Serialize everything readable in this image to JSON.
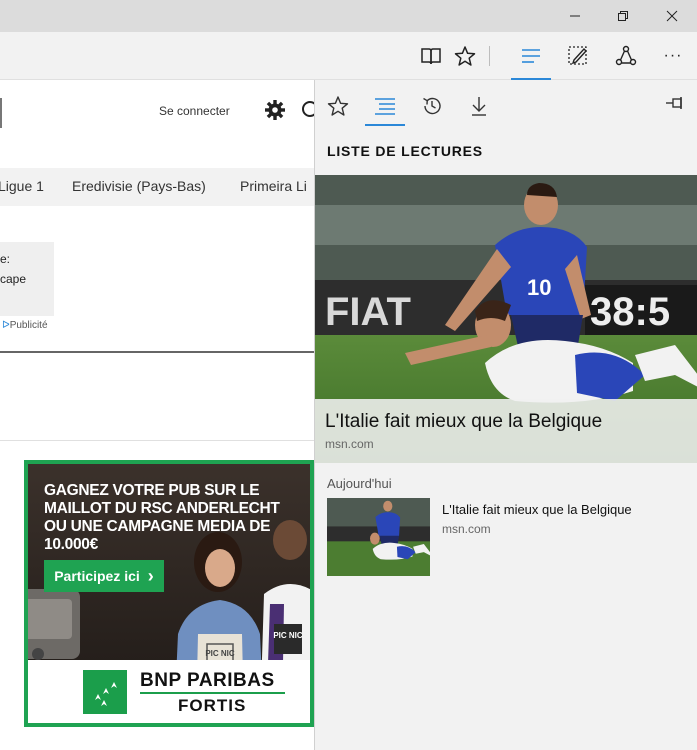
{
  "toolbar": {
    "icons": [
      "reading-view-icon",
      "favorites-star-icon",
      "hub-icon",
      "web-note-icon",
      "share-icon",
      "more-icon"
    ],
    "more_label": "···"
  },
  "page": {
    "signin": "Se connecter",
    "nav": [
      "Ligue 1",
      "Eredivisie (Pays-Bas)",
      "Primeira Li"
    ],
    "ad_lines": [
      "e:",
      "cape"
    ],
    "ad_label": "Publicité",
    "banner": {
      "title": "GAGNEZ VOTRE PUB SUR LE MAILLOT DU RSC ANDERLECHT OU UNE CAMPAGNE MEDIA DE 10.000€",
      "cta": "Participez ici",
      "cta_arrow": "›",
      "apron_left": "PIC NIC",
      "apron_right": "PIC NIC",
      "brand": "BNP PARIBAS",
      "brand_sub": "FORTIS"
    }
  },
  "hub": {
    "title": "LISTE DE LECTURES",
    "hero": {
      "title": "L'Italie fait mieux que la Belgique",
      "source": "msn.com",
      "scoreboard": "38:5",
      "ad_board": "FIAT",
      "jersey_number": "10"
    },
    "section": "Aujourd'hui",
    "items": [
      {
        "title": "L'Italie fait mieux que la Belgique",
        "source": "msn.com"
      }
    ]
  },
  "colors": {
    "accent": "#2b88d8",
    "green": "#1fa352"
  }
}
